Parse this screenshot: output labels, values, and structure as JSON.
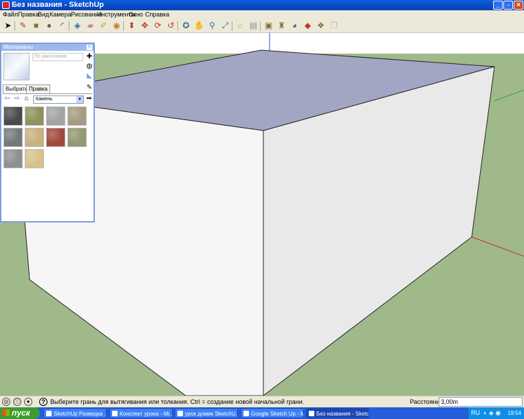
{
  "window": {
    "title": "Без названия - SketchUp",
    "min_label": "_",
    "max_label": "▫",
    "close_label": "✕"
  },
  "menu": [
    "Файл",
    "Правка",
    "Вид",
    "Камера",
    "Рисование",
    "Инструменты",
    "Окно",
    "Справка"
  ],
  "toolbar": {
    "tools": [
      {
        "name": "select-tool",
        "glyph": "➤",
        "color": "#000"
      },
      {
        "name": "pencil-tool",
        "glyph": "✎",
        "color": "#c0392b"
      },
      {
        "name": "rectangle-tool",
        "glyph": "■",
        "color": "#8a6d3b"
      },
      {
        "name": "circle-tool",
        "glyph": "●",
        "color": "#7a5c2e"
      },
      {
        "name": "arc-tool",
        "glyph": "◜",
        "color": "#333"
      },
      {
        "name": "make-component-tool",
        "glyph": "◈",
        "color": "#2e6da4"
      },
      {
        "name": "eraser-tool",
        "glyph": "▰",
        "color": "#d47fa6"
      },
      {
        "name": "tape-measure-tool",
        "glyph": "✐",
        "color": "#c9a227"
      },
      {
        "name": "paint-bucket-tool",
        "glyph": "◉",
        "color": "#c97a27"
      },
      {
        "name": "push-pull-tool",
        "glyph": "⬍",
        "color": "#b03a2e"
      },
      {
        "name": "move-tool",
        "glyph": "✥",
        "color": "#c0392b"
      },
      {
        "name": "rotate-tool",
        "glyph": "⟳",
        "color": "#c0392b"
      },
      {
        "name": "follow-me-tool",
        "glyph": "↺",
        "color": "#c0392b"
      },
      {
        "name": "orbit-tool",
        "glyph": "✪",
        "color": "#2e6da4"
      },
      {
        "name": "pan-tool",
        "glyph": "✋",
        "color": "#666"
      },
      {
        "name": "zoom-tool",
        "glyph": "⚲",
        "color": "#2e6da4"
      },
      {
        "name": "zoom-extents-tool",
        "glyph": "⤢",
        "color": "#2e6da4"
      },
      {
        "name": "add-location-tool",
        "glyph": "⌂",
        "color": "#c9a227"
      },
      {
        "name": "toggle-terrain-tool",
        "glyph": "▤",
        "color": "#888"
      },
      {
        "name": "photo-textures-tool",
        "glyph": "▣",
        "color": "#8a6d3b"
      },
      {
        "name": "get-models-tool",
        "glyph": "♜",
        "color": "#8a6d3b"
      },
      {
        "name": "share-model-tool",
        "glyph": "◕",
        "color": "#2e6da4"
      },
      {
        "name": "share-component-tool",
        "glyph": "◆",
        "color": "#c0392b"
      },
      {
        "name": "extension-warehouse-tool",
        "glyph": "❖",
        "color": "#8a6d3b"
      },
      {
        "name": "send-to-layout-tool",
        "glyph": "❒",
        "color": "#bbb"
      }
    ]
  },
  "materials": {
    "title": "Материалы",
    "name_placeholder": "По умолчанию",
    "tab_select": "Выбрать",
    "tab_edit": "Правка",
    "library": "Камень",
    "swatches": [
      "#4a4a4a",
      "#8f915f",
      "#a2a4a2",
      "#a59b82",
      "#74787c",
      "#c9b07e",
      "#a1473c",
      "#939772",
      "#8c8f93",
      "#d8c28a"
    ]
  },
  "status": {
    "message": "Выберите грань для вытягивания или толкания.  Ctrl = создание новой начальной грани.",
    "measure_label": "Расстояние",
    "measure_value": "3,00m"
  },
  "taskbar": {
    "start_label": "пуск",
    "tasks": [
      {
        "label": "SketchUp Разведка ...",
        "active": false
      },
      {
        "label": "Конспект урока - Mi...",
        "active": false
      },
      {
        "label": "урок домик SketchU...",
        "active": false
      },
      {
        "label": "Google Sketch Up - Mi...",
        "active": false
      },
      {
        "label": "Без названия - Sketc...",
        "active": true
      }
    ],
    "lang": "RU",
    "clock": "19:54"
  },
  "colors": {
    "ground": "#a0b98b",
    "roof": "#9fa3c0",
    "wall_left": "#f6f6f6",
    "wall_right": "#e9e9e9",
    "taskbar": "#245edb",
    "start": "#3c9b32"
  }
}
